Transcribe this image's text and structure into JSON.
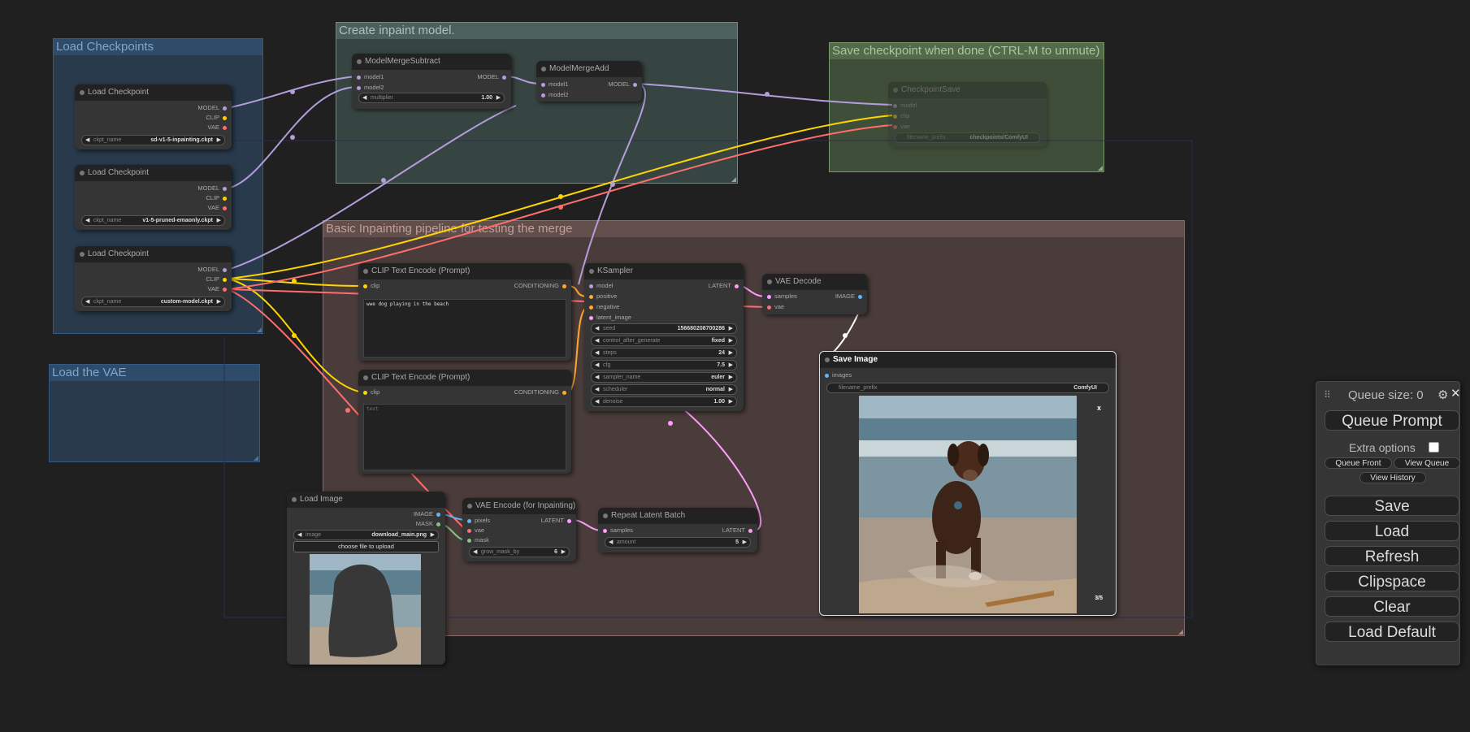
{
  "colors": {
    "background": "#202020",
    "node_body": "#353535",
    "node_title": "#222222",
    "link_model": "#b39ddb",
    "link_clip": "#ffd500",
    "link_vae": "#ff6e6e",
    "link_latent": "#ff9cf9",
    "link_image": "#64b5f6",
    "link_mask": "#81c784"
  },
  "groups": {
    "load_checkpoints": "Load Checkpoints",
    "create_inpaint": "Create inpaint model.",
    "save_checkpoint": "Save checkpoint when done (CTRL-M to unmute)",
    "basic_pipeline": "Basic Inpainting pipeline for testing the merge",
    "load_vae": "Load the VAE"
  },
  "nodes": {
    "ckpt1": {
      "title": "Load Checkpoint",
      "outputs": [
        "MODEL",
        "CLIP",
        "VAE"
      ],
      "widget_label": "ckpt_name",
      "widget_value": "sd-v1-5-inpainting.ckpt"
    },
    "ckpt2": {
      "title": "Load Checkpoint",
      "outputs": [
        "MODEL",
        "CLIP",
        "VAE"
      ],
      "widget_label": "ckpt_name",
      "widget_value": "v1-5-pruned-emaonly.ckpt"
    },
    "ckpt3": {
      "title": "Load Checkpoint",
      "outputs": [
        "MODEL",
        "CLIP",
        "VAE"
      ],
      "widget_label": "ckpt_name",
      "widget_value": "custom-model.ckpt"
    },
    "merge_subtract": {
      "title": "ModelMergeSubtract",
      "inputs": [
        "model1",
        "model2"
      ],
      "output": "MODEL",
      "widget_label": "multiplier",
      "widget_value": "1.00"
    },
    "merge_add": {
      "title": "ModelMergeAdd",
      "inputs": [
        "model1",
        "model2"
      ],
      "output": "MODEL"
    },
    "ckpt_save": {
      "title": "CheckpointSave",
      "inputs": [
        "model",
        "clip",
        "vae"
      ],
      "widget_label": "filename_prefix",
      "widget_value": "checkpoints/ComfyUI"
    },
    "clip_pos": {
      "title": "CLIP Text Encode (Prompt)",
      "input": "clip",
      "output": "CONDITIONING",
      "text": "wwe dog playing in the beach"
    },
    "clip_neg": {
      "title": "CLIP Text Encode (Prompt)",
      "input": "clip",
      "output": "CONDITIONING",
      "text": "text"
    },
    "ksampler": {
      "title": "KSampler",
      "inputs": [
        "model",
        "positive",
        "negative",
        "latent_image"
      ],
      "output": "LATENT",
      "widgets": [
        {
          "label": "seed",
          "value": "156680208700286"
        },
        {
          "label": "control_after_generate",
          "value": "fixed"
        },
        {
          "label": "steps",
          "value": "24"
        },
        {
          "label": "cfg",
          "value": "7.5"
        },
        {
          "label": "sampler_name",
          "value": "euler"
        },
        {
          "label": "scheduler",
          "value": "normal"
        },
        {
          "label": "denoise",
          "value": "1.00"
        }
      ]
    },
    "vae_decode": {
      "title": "VAE Decode",
      "inputs": [
        "samples",
        "vae"
      ],
      "output": "IMAGE"
    },
    "save_image": {
      "title": "Save Image",
      "input": "images",
      "widget_label": "filename_prefix",
      "widget_value": "ComfyUI",
      "counter": "3/5",
      "close": "x"
    },
    "load_image": {
      "title": "Load Image",
      "outputs": [
        "IMAGE",
        "MASK"
      ],
      "widget_label": "image",
      "widget_value": "download_main.png",
      "upload_button": "choose file to upload"
    },
    "vae_encode": {
      "title": "VAE Encode (for Inpainting)",
      "inputs": [
        "pixels",
        "vae",
        "mask"
      ],
      "output": "LATENT",
      "widget_label": "grow_mask_by",
      "widget_value": "6"
    },
    "repeat_latent": {
      "title": "Repeat Latent Batch",
      "input": "samples",
      "output": "LATENT",
      "widget_label": "amount",
      "widget_value": "5"
    }
  },
  "menu": {
    "queue_size": "Queue size: 0",
    "queue_prompt": "Queue Prompt",
    "extra_options": "Extra options",
    "queue_front": "Queue Front",
    "view_queue": "View Queue",
    "view_history": "View History",
    "save": "Save",
    "load": "Load",
    "refresh": "Refresh",
    "clipspace": "Clipspace",
    "clear": "Clear",
    "load_default": "Load Default",
    "settings_icon": "gear-icon",
    "close_icon": "close-icon",
    "drag_icon": "drag-handle-icon"
  }
}
